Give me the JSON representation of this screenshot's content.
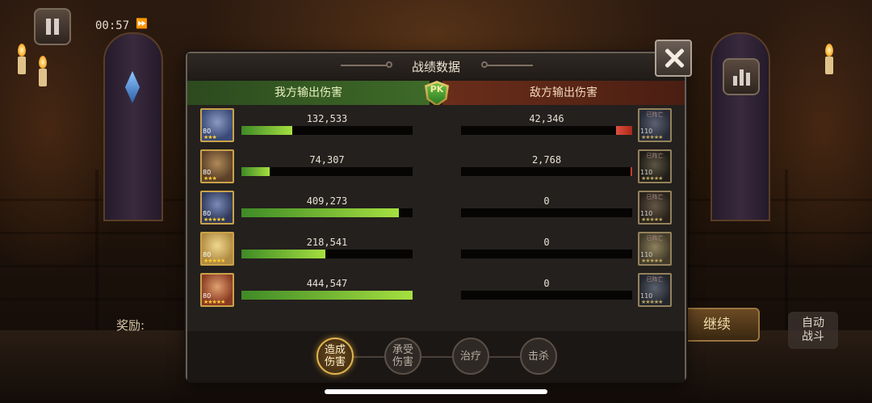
{
  "hud": {
    "timer": "00:57",
    "speed_label": "⏩",
    "reward_label": "奖励:",
    "continue_label": "继续",
    "auto_label_line1": "自动",
    "auto_label_line2": "战斗"
  },
  "panel": {
    "title": "战绩数据",
    "ally_header": "我方输出伤害",
    "enemy_header": "敌方输出伤害",
    "pk_label": "PK",
    "max_value": 444547
  },
  "allies": [
    {
      "value": 132533,
      "label": "132,533",
      "level": "80",
      "stars": "★★★",
      "colors": [
        "#3a4a78",
        "#8a9ac0"
      ]
    },
    {
      "value": 74307,
      "label": "74,307",
      "level": "80",
      "stars": "★★★",
      "colors": [
        "#5a4028",
        "#b08a58"
      ]
    },
    {
      "value": 409273,
      "label": "409,273",
      "level": "80",
      "stars": "★★★★★",
      "colors": [
        "#2e3858",
        "#7a8ab8"
      ]
    },
    {
      "value": 218541,
      "label": "218,541",
      "level": "80",
      "stars": "★★★★★",
      "colors": [
        "#b08a40",
        "#f0d890"
      ]
    },
    {
      "value": 444547,
      "label": "444,547",
      "level": "80",
      "stars": "★★★★★",
      "colors": [
        "#8a3a22",
        "#e0a070"
      ]
    }
  ],
  "enemies": [
    {
      "value": 42346,
      "label": "42,346",
      "level": "110",
      "status": "已阵亡",
      "stars": "★★★★★",
      "colors": [
        "#2e3650",
        "#6a7aa0"
      ]
    },
    {
      "value": 2768,
      "label": "2,768",
      "level": "110",
      "status": "已阵亡",
      "stars": "★★★★★",
      "colors": [
        "#2a2418",
        "#7a6a40"
      ]
    },
    {
      "value": 0,
      "label": "0",
      "level": "110",
      "status": "已阵亡",
      "stars": "★★★★★",
      "colors": [
        "#3a2a1a",
        "#8a6a44"
      ]
    },
    {
      "value": 0,
      "label": "0",
      "level": "110",
      "status": "已阵亡",
      "stars": "★★★★★",
      "colors": [
        "#5a4a22",
        "#c0a050"
      ]
    },
    {
      "value": 0,
      "label": "0",
      "level": "110",
      "status": "已阵亡",
      "stars": "★★★★★",
      "colors": [
        "#2a3040",
        "#6a7a98"
      ]
    }
  ],
  "tabs": [
    {
      "line1": "造成",
      "line2": "伤害",
      "active": true
    },
    {
      "line1": "承受",
      "line2": "伤害",
      "active": false
    },
    {
      "line1": "治疗",
      "line2": "",
      "active": false
    },
    {
      "line1": "击杀",
      "line2": "",
      "active": false
    }
  ]
}
